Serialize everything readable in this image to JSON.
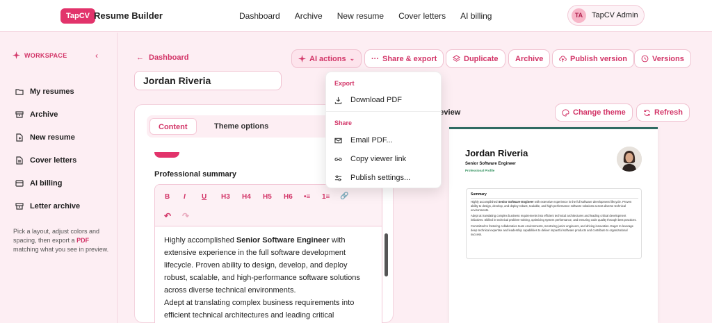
{
  "header": {
    "logo": "TapCV",
    "app_title": "Resume Builder",
    "nav": [
      "Dashboard",
      "Archive",
      "New resume",
      "Cover letters",
      "AI billing"
    ],
    "account": {
      "initials": "TA",
      "name": "TapCV Admin"
    }
  },
  "sidebar": {
    "section": "WORKSPACE",
    "toggle": "‹",
    "items": [
      {
        "label": "My resumes",
        "icon": "folder-icon"
      },
      {
        "label": "Archive",
        "icon": "archive-icon"
      },
      {
        "label": "New resume",
        "icon": "file-plus-icon"
      },
      {
        "label": "Cover letters",
        "icon": "document-icon"
      },
      {
        "label": "AI billing",
        "icon": "card-icon"
      },
      {
        "label": "Letter archive",
        "icon": "archive-icon"
      }
    ],
    "hint_before": "Pick a layout, adjust colors and spacing, then export a ",
    "hint_bold": "PDF",
    "hint_after": " matching what you see in preview."
  },
  "main": {
    "back_label": "Dashboard",
    "resume_name": "Jordan Riveria",
    "toolbar": {
      "ai_actions": "AI actions",
      "share_export": "Share & export",
      "duplicate": "Duplicate",
      "archive": "Archive",
      "publish_version": "Publish version",
      "versions": "Versions"
    },
    "tabs": [
      "Content",
      "Theme options"
    ],
    "section_label": "Professional summary",
    "rte_buttons": [
      "B",
      "I",
      "U",
      "H3",
      "H4",
      "H5",
      "H6",
      "•≡",
      "1≡",
      "🔗",
      "↶",
      "↷"
    ],
    "summary_before": "Highly accomplished ",
    "summary_bold": "Senior Software Engineer",
    "summary_after": " with extensive experience in the full software development lifecycle. Proven ability to design, develop, and deploy robust, scalable, and high-performance software solutions across diverse technical environments.",
    "summary_p2": "Adept at translating complex business requirements into efficient technical architectures and leading critical development initiatives. Skilled in technical problem-solving"
  },
  "dropdown": {
    "export_label": "Export",
    "download_pdf": "Download PDF",
    "share_label": "Share",
    "email_pdf": "Email PDF...",
    "copy_link": "Copy viewer link",
    "publish_settings": "Publish settings..."
  },
  "preview": {
    "label": "review",
    "change_theme": "Change theme",
    "refresh": "Refresh",
    "doc": {
      "name": "Jordan Riveria",
      "role": "Senior Software Engineer",
      "profile": "Professional Profile",
      "summary_title": "Summary",
      "p1_before": "Highly accomplished ",
      "p1_bold": "Senior Software Engineer",
      "p1_after": " with extensive experience in the full software development lifecycle. Proven ability to design, develop, and deploy robust, scalable, and high-performance software solutions across diverse technical environments.",
      "p2": "Adept at translating complex business requirements into efficient technical architectures and leading critical development initiatives. Skilled in technical problem-solving, optimizing system performance, and ensuring code quality through best practices.",
      "p3": "Committed to fostering collaborative team environments, mentoring junior engineers, and driving innovation. Eager to leverage deep technical expertise and leadership capabilities to deliver impactful software products and contribute to organizational success."
    }
  },
  "colors": {
    "accent": "#e2336b",
    "accent_text": "#d23467",
    "bg": "#fdeef3",
    "preview_rule": "#2f6a62"
  }
}
